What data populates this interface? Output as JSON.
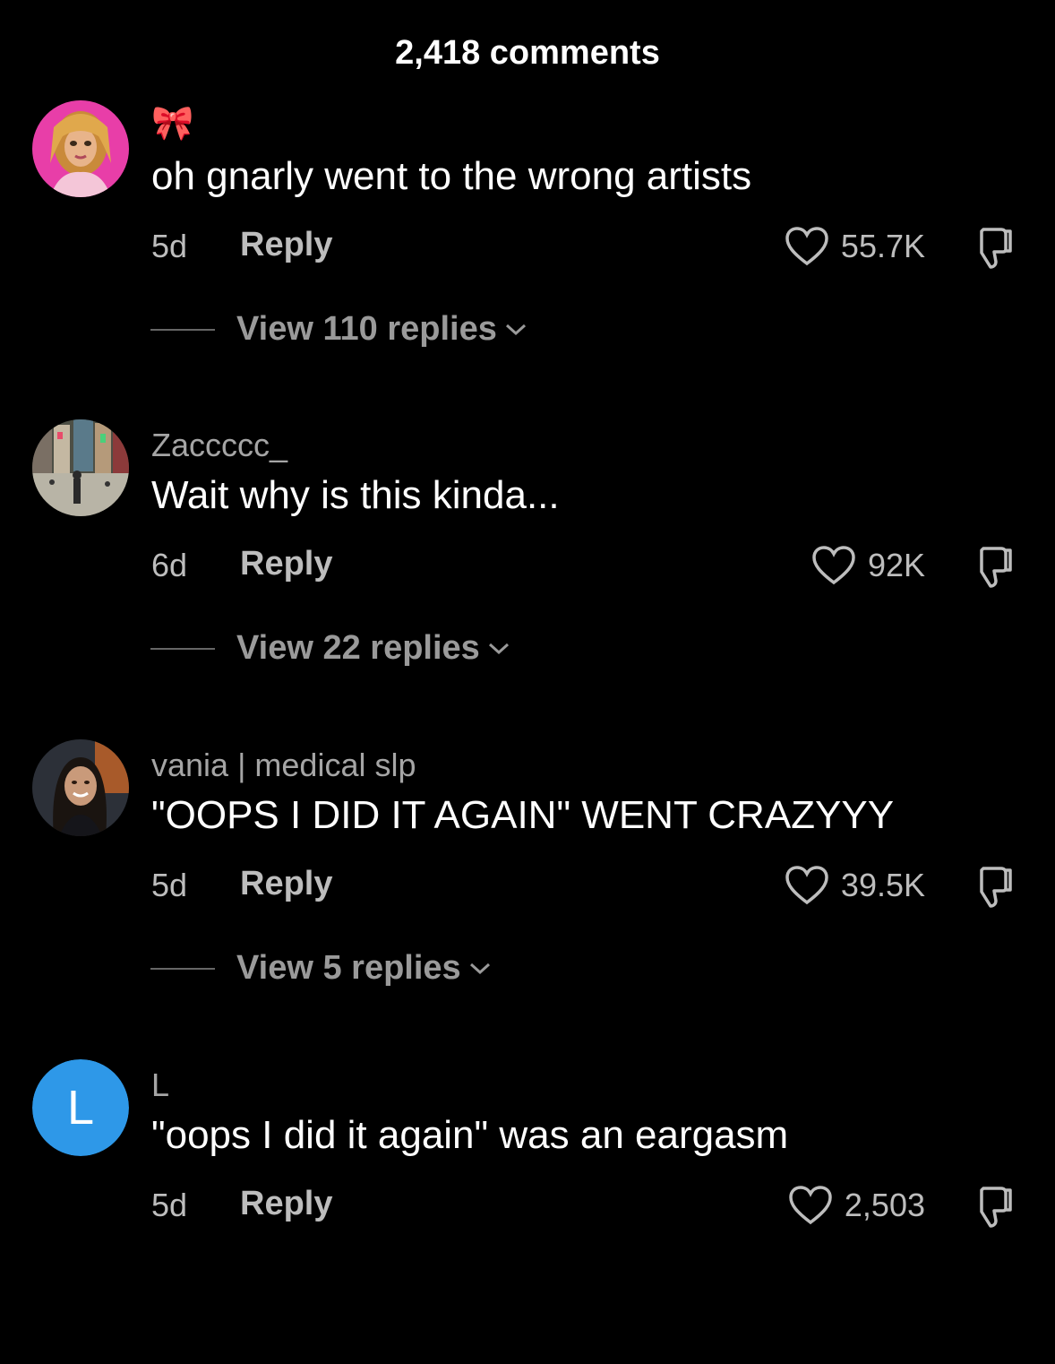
{
  "header": {
    "title": "2,418 comments"
  },
  "comments": [
    {
      "username": "🎀",
      "text": "oh gnarly went to the wrong artists",
      "time": "5d",
      "reply_label": "Reply",
      "likes": "55.7K",
      "view_replies": "View 110 replies",
      "avatar": {
        "type": "image",
        "icon": "doll-avatar",
        "accent": "#e83ea8"
      }
    },
    {
      "username": "Zaccccc_",
      "text": "Wait why is this kinda...",
      "time": "6d",
      "reply_label": "Reply",
      "likes": "92K",
      "view_replies": "View 22 replies",
      "avatar": {
        "type": "image",
        "icon": "city-street-avatar",
        "accent": "#6b6f5a"
      }
    },
    {
      "username": "vania | medical slp",
      "text": "\"OOPS I DID IT AGAIN\" WENT CRAZYYY",
      "time": "5d",
      "reply_label": "Reply",
      "likes": "39.5K",
      "view_replies": "View 5 replies",
      "avatar": {
        "type": "image",
        "icon": "person-avatar",
        "accent": "#3a3f4a"
      }
    },
    {
      "username": "L",
      "text": "\"oops I did it again\" was an eargasm",
      "time": "5d",
      "reply_label": "Reply",
      "likes": "2,503",
      "avatar": {
        "type": "letter",
        "letter": "L",
        "accent": "#2e98e8"
      }
    }
  ],
  "colors": {
    "background": "#000000",
    "primary_text": "#ffffff",
    "secondary_text": "#bdbdbd",
    "username_text": "#a5a5a5"
  }
}
